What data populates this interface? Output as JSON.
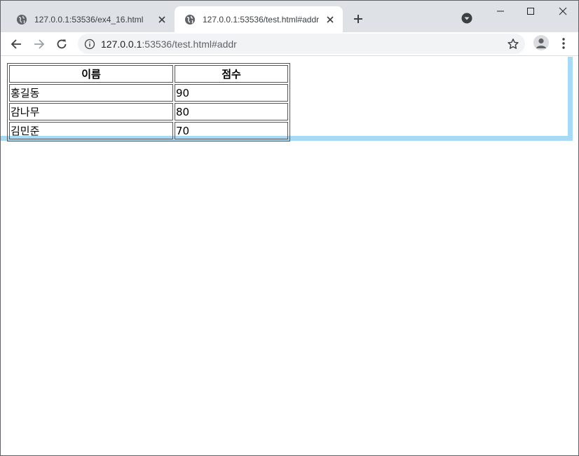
{
  "browser": {
    "tabs": [
      {
        "title": "127.0.0.1:53536/ex4_16.html",
        "active": false
      },
      {
        "title": "127.0.0.1:53536/test.html#addr",
        "active": true
      }
    ],
    "address": {
      "host": "127.0.0.1",
      "rest": ":53536/test.html#addr"
    },
    "icons": {
      "tab_favicon": "globe-icon",
      "new_tab": "plus-icon",
      "tab_search": "dropdown-circle-icon",
      "back": "arrow-left-icon",
      "forward": "arrow-right-icon",
      "reload": "reload-icon",
      "site_info": "info-icon",
      "bookmark": "star-icon",
      "profile": "person-icon",
      "menu": "kebab-menu-icon"
    }
  },
  "table": {
    "headers": [
      "이름",
      "점수"
    ],
    "rows": [
      [
        "홍길동",
        "90"
      ],
      [
        "감나무",
        "80"
      ],
      [
        "김민준",
        "70"
      ]
    ]
  },
  "colors": {
    "tabstrip": "#dee1e6",
    "omnibox": "#f1f3f4",
    "highlight": "#a8daf6"
  }
}
